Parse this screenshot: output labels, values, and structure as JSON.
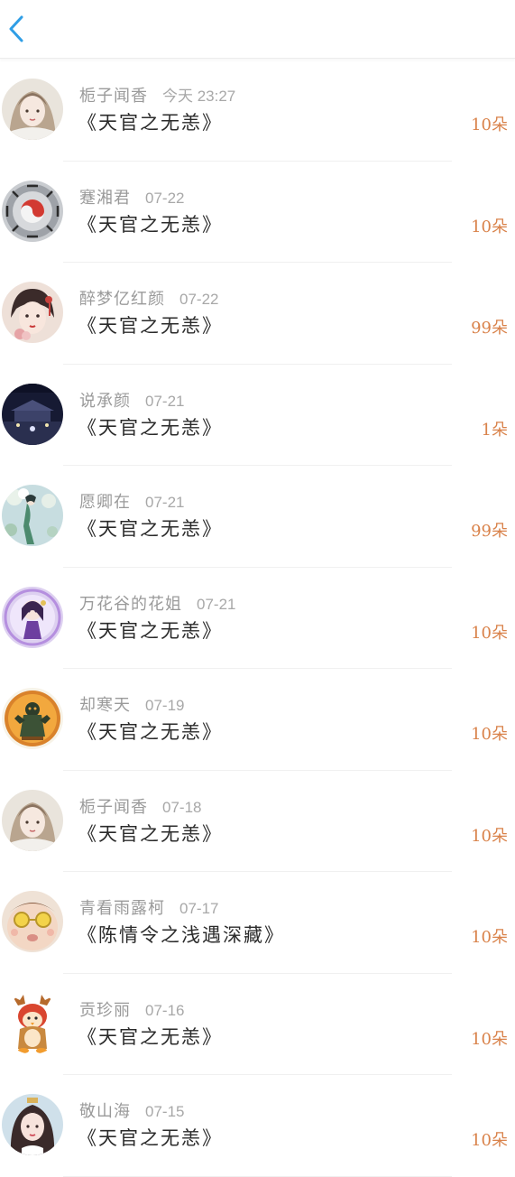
{
  "header": {
    "back_icon": "chevron-left-icon",
    "accent": "#2f9ee6"
  },
  "colors": {
    "gift_text": "#d9824a",
    "meta_text": "#9a9a9a",
    "title_text": "#2b2b2b"
  },
  "records": [
    {
      "name": "栀子闻香",
      "time": "今天 23:27",
      "title": "《天官之无恙》",
      "gift": "10朵",
      "avatar": "avatar-hanfu-girl"
    },
    {
      "name": "蹇湘君",
      "time": "07-22",
      "title": "《天官之无恙》",
      "gift": "10朵",
      "avatar": "avatar-bagua"
    },
    {
      "name": "醉梦亿红颜",
      "time": "07-22",
      "title": "《天官之无恙》",
      "gift": "99朵",
      "avatar": "avatar-painted-girl"
    },
    {
      "name": "说承颜",
      "time": "07-21",
      "title": "《天官之无恙》",
      "gift": "1朵",
      "avatar": "avatar-night-scene"
    },
    {
      "name": "愿卿在",
      "time": "07-21",
      "title": "《天官之无恙》",
      "gift": "99朵",
      "avatar": "avatar-flowers"
    },
    {
      "name": "万花谷的花姐",
      "time": "07-21",
      "title": "《天官之无恙》",
      "gift": "10朵",
      "avatar": "avatar-chibi-purple"
    },
    {
      "name": "却寒天",
      "time": "07-19",
      "title": "《天官之无恙》",
      "gift": "10朵",
      "avatar": "avatar-orange-badge"
    },
    {
      "name": "栀子闻香",
      "time": "07-18",
      "title": "《天官之无恙》",
      "gift": "10朵",
      "avatar": "avatar-hanfu-girl"
    },
    {
      "name": "青看雨露柯",
      "time": "07-17",
      "title": "《陈情令之浅遇深藏》",
      "gift": "10朵",
      "avatar": "avatar-baby-glasses"
    },
    {
      "name": "贡珍丽",
      "time": "07-16",
      "title": "《天官之无恙》",
      "gift": "10朵",
      "avatar": "avatar-cartoon-penguin"
    },
    {
      "name": "敬山海",
      "time": "07-15",
      "title": "《天官之无恙》",
      "gift": "10朵",
      "avatar": "avatar-longhair-girl"
    }
  ]
}
